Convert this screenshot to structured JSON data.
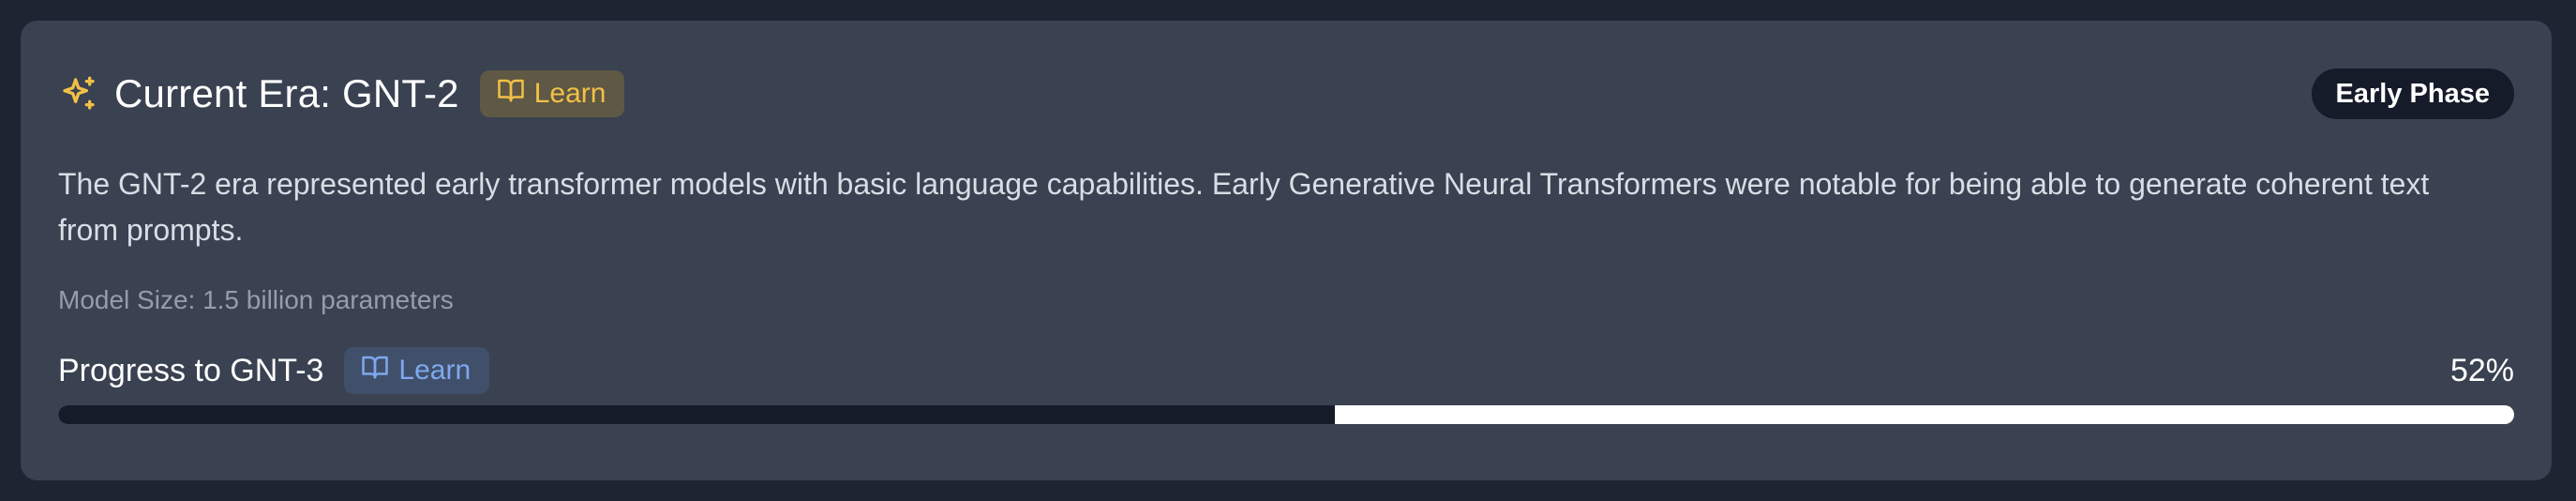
{
  "era_card": {
    "title": "Current Era: GNT-2",
    "learn_label": "Learn",
    "phase_badge": "Early Phase",
    "description": "The GNT-2 era represented early transformer models with basic language capabilities. Early Generative Neural Transformers were notable for being able to generate coherent text from prompts.",
    "model_size": "Model Size: 1.5 billion parameters"
  },
  "progress": {
    "label": "Progress to GNT-3",
    "learn_label": "Learn",
    "percent_text": "52%",
    "value": 0.52
  },
  "icons": {
    "title_icon": "sparkles-icon",
    "learn_icon": "book-open-icon"
  },
  "colors": {
    "accent_amber": "#f2c046",
    "accent_blue": "#7fa8f0",
    "card_bg": "#3a4251",
    "page_bg": "#1d2432",
    "badge_dark": "#151b29"
  }
}
